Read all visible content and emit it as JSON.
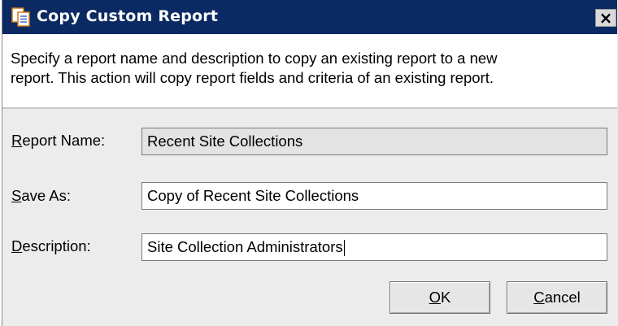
{
  "window": {
    "title": "Copy Custom Report",
    "close_glyph": "×"
  },
  "instructions": {
    "line1": "Specify a report name and description to copy an existing report to a new",
    "line2": "report. This action will copy report fields and criteria of an existing report."
  },
  "form": {
    "report_name": {
      "label_accel": "R",
      "label_rest": "eport Name:",
      "value": "Recent Site Collections"
    },
    "save_as": {
      "label_accel": "S",
      "label_rest": "ave As:",
      "value": "Copy of Recent Site Collections"
    },
    "description": {
      "label_accel": "D",
      "label_rest": "escription:",
      "value": "Site Collection Administrators"
    }
  },
  "buttons": {
    "ok": {
      "accel": "O",
      "rest": "K"
    },
    "cancel": {
      "accel": "C",
      "rest": "ancel"
    }
  },
  "colors": {
    "titlebar": "#0b2a63",
    "dialog_bg": "#ececec"
  },
  "icons": {
    "title_icon": "copy-document-icon",
    "close": "close-icon"
  }
}
